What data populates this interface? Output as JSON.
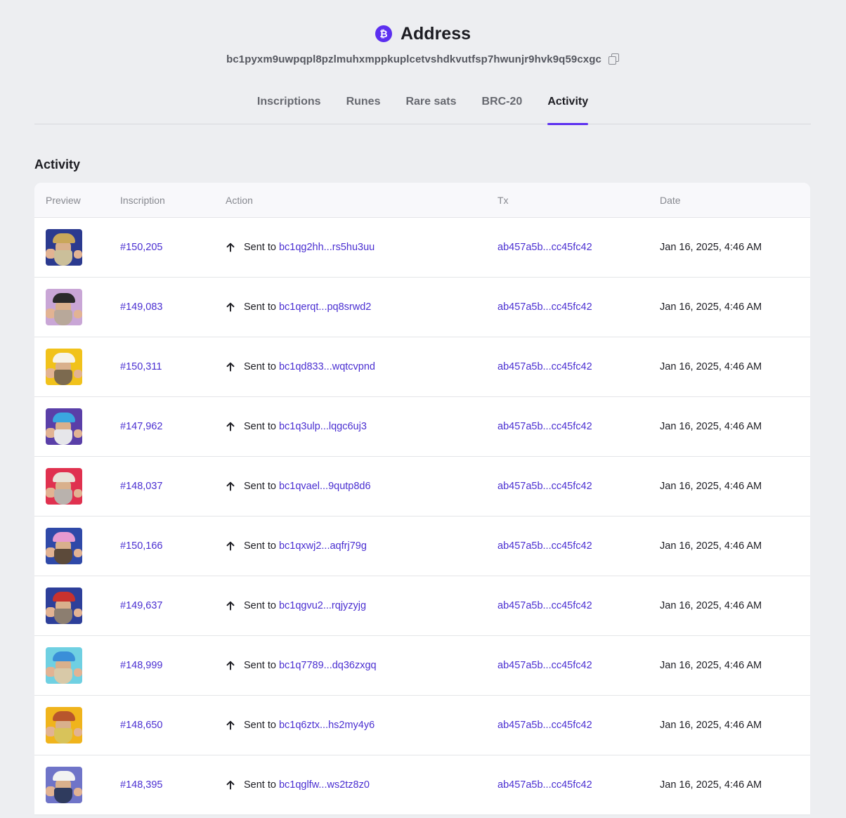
{
  "header": {
    "icon": "bitcoin-icon",
    "icon_glyph": "₿",
    "title": "Address",
    "address": "bc1pyxm9uwpqpl8pzlmuhxmppkuplcetvshdkvutfsp7hwunjr9hvk9q59cxgc"
  },
  "tabs": [
    {
      "label": "Inscriptions",
      "active": false
    },
    {
      "label": "Runes",
      "active": false
    },
    {
      "label": "Rare sats",
      "active": false
    },
    {
      "label": "BRC-20",
      "active": false
    },
    {
      "label": "Activity",
      "active": true
    }
  ],
  "section": {
    "title": "Activity"
  },
  "table": {
    "headers": {
      "preview": "Preview",
      "inscription": "Inscription",
      "action": "Action",
      "tx": "Tx",
      "date": "Date"
    },
    "rows": [
      {
        "inscription": "#150,205",
        "action": "Sent to",
        "recipient": "bc1qg2hh...rs5hu3uu",
        "tx": "ab457a5b...cc45fc42",
        "date": "Jan 16, 2025, 4:46 AM",
        "thumb": {
          "bg": "#2b3a8f",
          "hat": "#c9a75a",
          "beard": "#cbbf9a"
        }
      },
      {
        "inscription": "#149,083",
        "action": "Sent to",
        "recipient": "bc1qerqt...pq8srwd2",
        "tx": "ab457a5b...cc45fc42",
        "date": "Jan 16, 2025, 4:46 AM",
        "thumb": {
          "bg": "#c9a6d6",
          "hat": "#2a2a2a",
          "beard": "#b8a89a"
        }
      },
      {
        "inscription": "#150,311",
        "action": "Sent to",
        "recipient": "bc1qd833...wqtcvpnd",
        "tx": "ab457a5b...cc45fc42",
        "date": "Jan 16, 2025, 4:46 AM",
        "thumb": {
          "bg": "#f1c21b",
          "hat": "#f7f3e8",
          "beard": "#7c6a4f"
        }
      },
      {
        "inscription": "#147,962",
        "action": "Sent to",
        "recipient": "bc1q3ulp...lqgc6uj3",
        "tx": "ab457a5b...cc45fc42",
        "date": "Jan 16, 2025, 4:46 AM",
        "thumb": {
          "bg": "#5a3fa8",
          "hat": "#3aa7e0",
          "beard": "#e6e6ea"
        }
      },
      {
        "inscription": "#148,037",
        "action": "Sent to",
        "recipient": "bc1qvael...9qutp8d6",
        "tx": "ab457a5b...cc45fc42",
        "date": "Jan 16, 2025, 4:46 AM",
        "thumb": {
          "bg": "#e0314f",
          "hat": "#e8e2d8",
          "beard": "#b9b2ad"
        }
      },
      {
        "inscription": "#150,166",
        "action": "Sent to",
        "recipient": "bc1qxwj2...aqfrj79g",
        "tx": "ab457a5b...cc45fc42",
        "date": "Jan 16, 2025, 4:46 AM",
        "thumb": {
          "bg": "#2f49a8",
          "hat": "#e79ad0",
          "beard": "#5c4a3a"
        }
      },
      {
        "inscription": "#149,637",
        "action": "Sent to",
        "recipient": "bc1qgvu2...rqjyzyjg",
        "tx": "ab457a5b...cc45fc42",
        "date": "Jan 16, 2025, 4:46 AM",
        "thumb": {
          "bg": "#2d3f9a",
          "hat": "#c8322e",
          "beard": "#8c7e70"
        }
      },
      {
        "inscription": "#148,999",
        "action": "Sent to",
        "recipient": "bc1q7789...dq36zxgq",
        "tx": "ab457a5b...cc45fc42",
        "date": "Jan 16, 2025, 4:46 AM",
        "thumb": {
          "bg": "#6fd0e2",
          "hat": "#3a8fd8",
          "beard": "#d8c9a8"
        }
      },
      {
        "inscription": "#148,650",
        "action": "Sent to",
        "recipient": "bc1q6ztx...hs2my4y6",
        "tx": "ab457a5b...cc45fc42",
        "date": "Jan 16, 2025, 4:46 AM",
        "thumb": {
          "bg": "#f0b41c",
          "hat": "#b8562c",
          "beard": "#d8c35a"
        }
      },
      {
        "inscription": "#148,395",
        "action": "Sent to",
        "recipient": "bc1qglfw...ws2tz8z0",
        "tx": "ab457a5b...cc45fc42",
        "date": "Jan 16, 2025, 4:46 AM",
        "thumb": {
          "bg": "#6f74c8",
          "hat": "#f2f2f2",
          "beard": "#2f3b5e"
        }
      }
    ]
  },
  "colors": {
    "accent": "#5c2ff0",
    "link": "#4a2fd1",
    "background": "#edeef1"
  }
}
